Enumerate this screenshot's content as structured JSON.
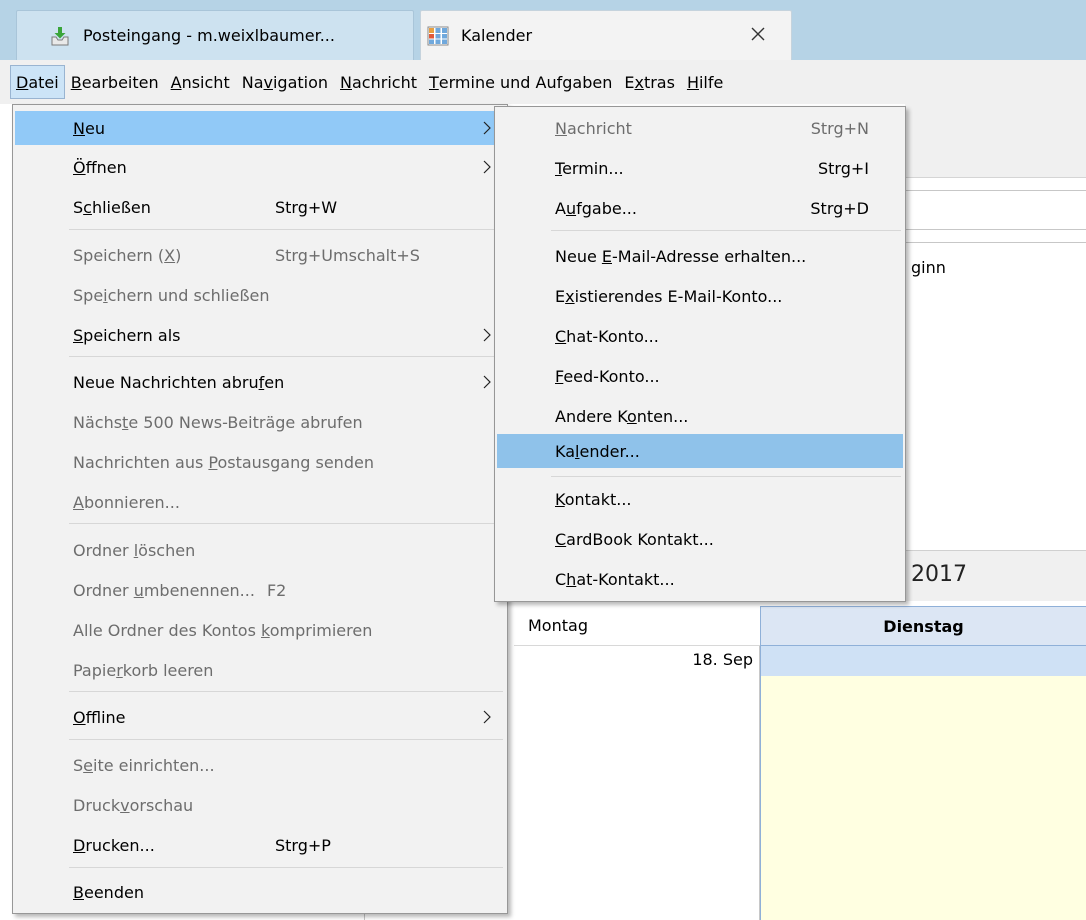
{
  "tabs": [
    {
      "label": "Posteingang - m.weixlbaumer...",
      "icon": "inbox-download-icon",
      "active": false
    },
    {
      "label": "Kalender",
      "icon": "calendar-icon",
      "active": true
    }
  ],
  "menubar": [
    {
      "label": "Datei",
      "mnemonic": "D",
      "rest": "atei",
      "open": true
    },
    {
      "label": "Bearbeiten",
      "mnemonic": "B",
      "rest": "earbeiten"
    },
    {
      "label": "Ansicht",
      "mnemonic": "A",
      "rest": "nsicht"
    },
    {
      "label": "Navigation",
      "pre": "Na",
      "mnemonic": "v",
      "rest": "igation"
    },
    {
      "label": "Nachricht",
      "mnemonic": "N",
      "rest": "achricht"
    },
    {
      "label": "Termine und Aufgaben",
      "mnemonic": "T",
      "rest": "ermine und Aufgaben"
    },
    {
      "label": "Extras",
      "pre": "E",
      "mnemonic": "x",
      "rest": "tras"
    },
    {
      "label": "Hilfe",
      "mnemonic": "H",
      "rest": "ilfe"
    }
  ],
  "datei_menu": {
    "neu": {
      "pre": "",
      "mn": "N",
      "post": "eu"
    },
    "oeffnen": {
      "pre": "",
      "mn": "Ö",
      "post": "ffnen"
    },
    "schliessen": {
      "pre": "S",
      "mn": "c",
      "post": "hließen",
      "shortcut": "Strg+W"
    },
    "speichern": {
      "pre": "Speichern (",
      "mn": "X",
      "post": ")",
      "shortcut": "Strg+Umschalt+S"
    },
    "speichern_schliessen": {
      "pre": "Spe",
      "mn": "i",
      "post": "chern und schließen"
    },
    "speichern_als": {
      "pre": "",
      "mn": "S",
      "post": "peichern als"
    },
    "neue_nachrichten": {
      "pre": "Neue Nachrichten abru",
      "mn": "f",
      "post": "en"
    },
    "naechste_500": {
      "pre": "Nächs",
      "mn": "t",
      "post": "e 500 News-Beiträge abrufen"
    },
    "postausgang": {
      "pre": "Nachrichten aus ",
      "mn": "P",
      "post": "ostausgang senden"
    },
    "abonnieren": {
      "pre": "",
      "mn": "A",
      "post": "bonnieren..."
    },
    "ordner_loeschen": {
      "pre": "Ordner ",
      "mn": "l",
      "post": "öschen"
    },
    "ordner_umbenennen": {
      "pre": "Ordner ",
      "mn": "u",
      "post": "mbenennen...",
      "shortcut": "F2"
    },
    "komprimieren": {
      "pre": "Alle Ordner des Kontos ",
      "mn": "k",
      "post": "omprimieren"
    },
    "papierkorb": {
      "pre": "Papie",
      "mn": "r",
      "post": "korb leeren"
    },
    "offline": {
      "pre": "",
      "mn": "O",
      "post": "ffline"
    },
    "seite": {
      "pre": "S",
      "mn": "e",
      "post": "ite einrichten..."
    },
    "druckvorschau": {
      "pre": "Druck",
      "mn": "v",
      "post": "orschau"
    },
    "drucken": {
      "pre": "",
      "mn": "D",
      "post": "rucken...",
      "shortcut": "Strg+P"
    },
    "beenden": {
      "pre": "",
      "mn": "B",
      "post": "eenden"
    }
  },
  "neu_menu": {
    "nachricht": {
      "pre": "",
      "mn": "N",
      "post": "achricht",
      "shortcut": "Strg+N"
    },
    "termin": {
      "pre": "",
      "mn": "T",
      "post": "ermin...",
      "shortcut": "Strg+I"
    },
    "aufgabe": {
      "pre": "A",
      "mn": "u",
      "post": "fgabe...",
      "shortcut": "Strg+D"
    },
    "neue_email": {
      "pre": "Neue ",
      "mn": "E",
      "post": "-Mail-Adresse erhalten..."
    },
    "existierendes": {
      "pre": "E",
      "mn": "x",
      "post": "istierendes E-Mail-Konto..."
    },
    "chat_konto": {
      "pre": "",
      "mn": "C",
      "post": "hat-Konto..."
    },
    "feed_konto": {
      "pre": "",
      "mn": "F",
      "post": "eed-Konto..."
    },
    "andere": {
      "pre": "Andere K",
      "mn": "o",
      "post": "nten..."
    },
    "kalender": {
      "pre": "Ka",
      "mn": "l",
      "post": "ender..."
    },
    "kontakt": {
      "pre": "",
      "mn": "K",
      "post": "ontakt..."
    },
    "cardbook": {
      "pre": "",
      "mn": "C",
      "post": "ardBook Kontakt..."
    },
    "chat_kontakt": {
      "pre": "C",
      "mn": "h",
      "post": "at-Kontakt..."
    }
  },
  "background": {
    "beginn_fragment": "ginn",
    "year_fragment": "2017",
    "day_montag": "Montag",
    "day_dienstag": "Dienstag",
    "date_montag": "18. Sep"
  },
  "colors": {
    "tabbar": "#b6d3e6",
    "menu_highlight": "#91c9f7",
    "today_column": "#ffffe1"
  }
}
